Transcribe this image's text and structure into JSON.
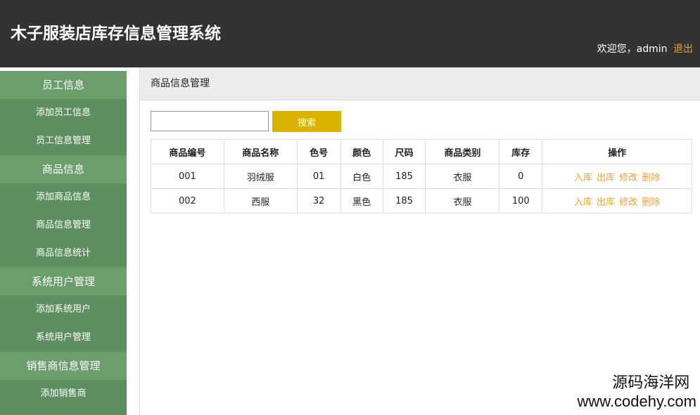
{
  "header": {
    "title": "木子服装店库存信息管理系统",
    "welcome": "欢迎您，admin",
    "logout": "退出"
  },
  "sidebar": {
    "groups": [
      {
        "label": "员工信息",
        "items": [
          "添加员工信息",
          "员工信息管理"
        ]
      },
      {
        "label": "商品信息",
        "items": [
          "添加商品信息",
          "商品信息管理",
          "商品信息统计"
        ]
      },
      {
        "label": "系统用户管理",
        "items": [
          "添加系统用户",
          "系统用户管理"
        ]
      },
      {
        "label": "销售商信息管理",
        "items": [
          "添加销售商"
        ]
      }
    ]
  },
  "main": {
    "breadcrumb": "商品信息管理",
    "search": {
      "value": "",
      "placeholder": "",
      "button": "搜索"
    },
    "table": {
      "headers": [
        "商品编号",
        "商品名称",
        "色号",
        "颜色",
        "尺码",
        "商品类别",
        "库存",
        "操作"
      ],
      "rows": [
        [
          "001",
          "羽绒服",
          "01",
          "白色",
          "185",
          "衣服",
          "0"
        ],
        [
          "002",
          "西服",
          "32",
          "黑色",
          "185",
          "衣服",
          "100"
        ]
      ],
      "actions": [
        "入库",
        "出库",
        "修改",
        "删除"
      ]
    }
  },
  "watermark": {
    "line1": "源码海洋网",
    "line2": "www.codehy.com"
  },
  "colors": {
    "header_bg": "#333333",
    "sidebar_group": "#6a9e6c",
    "sidebar_item": "#5e8f60",
    "accent": "#d9b300",
    "link": "#e9a23c",
    "logout": "#f0a020"
  }
}
